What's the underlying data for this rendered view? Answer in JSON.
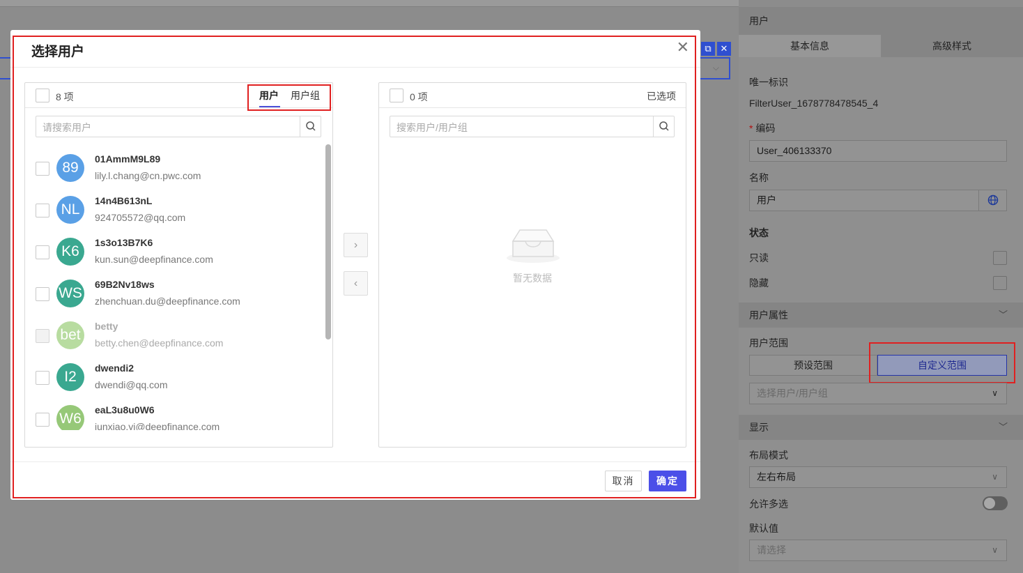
{
  "background": {
    "badge_copy": "⧉",
    "badge_close": "✕"
  },
  "right_panel": {
    "title": "用户",
    "tabs": [
      {
        "label": "基本信息",
        "active": true
      },
      {
        "label": "高级样式",
        "active": false
      }
    ],
    "unique_id_label": "唯一标识",
    "unique_id_value": "FilterUser_1678778478545_4",
    "code_required_mark": "*",
    "code_label": "编码",
    "code_value": "User_406133370",
    "name_label": "名称",
    "name_value": "用户",
    "status_label": "状态",
    "readonly_label": "只读",
    "hidden_label": "隐藏",
    "user_attr_section": "用户属性",
    "user_range_label": "用户范围",
    "range_preset": "预设范围",
    "range_custom": "自定义范围",
    "select_placeholder": "选择用户/用户组",
    "display_section": "显示",
    "layout_label": "布局模式",
    "layout_value": "左右布局",
    "multi_label": "允许多选",
    "default_label": "默认值",
    "default_placeholder": "请选择",
    "accent_color": "#2433a8"
  },
  "modal": {
    "title": "选择用户",
    "close_glyph": "✕",
    "left": {
      "count": "8 项",
      "tabs": [
        "用户",
        "用户组"
      ],
      "search_placeholder": "请搜索用户",
      "users": [
        {
          "avatar": "89",
          "name": "01AmmM9L89",
          "email": "lily.l.chang@cn.pwc.com",
          "color": "#5aa0e6",
          "disabled": false
        },
        {
          "avatar": "NL",
          "name": "14n4B613nL",
          "email": "924705572@qq.com",
          "color": "#5aa0e6",
          "disabled": false
        },
        {
          "avatar": "K6",
          "name": "1s3o13B7K6",
          "email": "kun.sun@deepfinance.com",
          "color": "#3aa890",
          "disabled": false
        },
        {
          "avatar": "WS",
          "name": "69B2Nv18ws",
          "email": "zhenchuan.du@deepfinance.com",
          "color": "#3aa890",
          "disabled": false
        },
        {
          "avatar": "bet",
          "name": "betty",
          "email": "betty.chen@deepfinance.com",
          "color": "#b8dca0",
          "disabled": true
        },
        {
          "avatar": "I2",
          "name": "dwendi2",
          "email": "dwendi@qq.com",
          "color": "#3aa890",
          "disabled": false
        },
        {
          "avatar": "W6",
          "name": "eaL3u8u0W6",
          "email": "junxiao.yi@deepfinance.com",
          "color": "#96c878",
          "disabled": false
        }
      ]
    },
    "transfer_right_glyph": "›",
    "transfer_left_glyph": "‹",
    "right": {
      "count": "0 项",
      "title": "已选项",
      "search_placeholder": "搜索用户/用户组",
      "empty_text": "暂无数据"
    },
    "cancel_label": "取消",
    "ok_label": "确定",
    "primary_color": "#4b4fe8"
  }
}
